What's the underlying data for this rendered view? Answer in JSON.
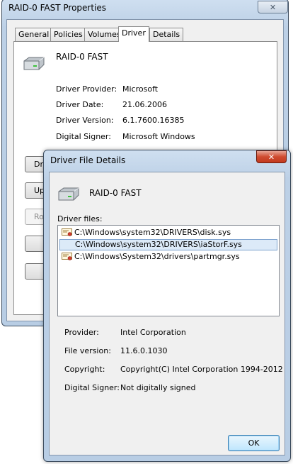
{
  "properties": {
    "title": "RAID-0 FAST Properties",
    "close_label": "✕",
    "tabs": [
      {
        "label": "General"
      },
      {
        "label": "Policies"
      },
      {
        "label": "Volumes"
      },
      {
        "label": "Driver"
      },
      {
        "label": "Details"
      }
    ],
    "active_tab": "Driver",
    "device_name": "RAID-0 FAST",
    "rows": [
      {
        "label": "Driver Provider:",
        "value": "Microsoft"
      },
      {
        "label": "Driver Date:",
        "value": "21.06.2006"
      },
      {
        "label": "Driver Version:",
        "value": "6.1.7600.16385"
      },
      {
        "label": "Digital Signer:",
        "value": "Microsoft Windows"
      }
    ],
    "buttons": [
      {
        "label": "Dr",
        "enabled": true
      },
      {
        "label": "Up",
        "enabled": true
      },
      {
        "label": "Rol",
        "enabled": false
      },
      {
        "label": "",
        "enabled": true
      },
      {
        "label": "",
        "enabled": true
      }
    ]
  },
  "details": {
    "title": "Driver File Details",
    "close_label": "✕",
    "device_name": "RAID-0 FAST",
    "files_label": "Driver files:",
    "files": [
      {
        "path": "C:\\Windows\\system32\\DRIVERS\\disk.sys",
        "icon": "certificate-icon",
        "selected": false
      },
      {
        "path": "C:\\Windows\\system32\\DRIVERS\\iaStorF.sys",
        "icon": "",
        "selected": true
      },
      {
        "path": "C:\\Windows\\System32\\drivers\\partmgr.sys",
        "icon": "certificate-icon",
        "selected": false
      }
    ],
    "info": [
      {
        "label": "Provider:",
        "value": "Intel Corporation"
      },
      {
        "label": "File version:",
        "value": "11.6.0.1030"
      },
      {
        "label": "Copyright:",
        "value": "Copyright(C) Intel Corporation 1994-2012"
      },
      {
        "label": "Digital Signer:",
        "value": "Not digitally signed"
      }
    ],
    "ok_label": "OK"
  },
  "colors": {
    "selection_bg": "#dceaf8",
    "close_red": "#c23a1f",
    "frame": "#bcd0e6"
  }
}
